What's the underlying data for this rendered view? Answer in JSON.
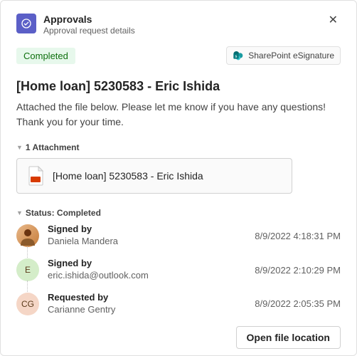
{
  "header": {
    "title": "Approvals",
    "subtitle": "Approval request details"
  },
  "status_badge": "Completed",
  "provider": "SharePoint eSignature",
  "request": {
    "title": "[Home loan] 5230583 - Eric Ishida",
    "message": "Attached the file below. Please let me know if you have any questions! Thank you for your time."
  },
  "attachments": {
    "header": "1 Attachment",
    "items": [
      {
        "name": "[Home loan] 5230583 - Eric Ishida"
      }
    ]
  },
  "status_section": {
    "header": "Status: Completed",
    "timeline": [
      {
        "action": "Signed by",
        "user": "Daniela Mandera",
        "timestamp": "8/9/2022 4:18:31 PM",
        "avatar_type": "photo",
        "avatar_bg": "#d9b38c"
      },
      {
        "action": "Signed by",
        "user": "eric.ishida@outlook.com",
        "timestamp": "8/9/2022 2:10:29 PM",
        "avatar_type": "initial",
        "avatar_text": "E",
        "avatar_bg": "#d4edc9"
      },
      {
        "action": "Requested by",
        "user": "Carianne Gentry",
        "timestamp": "8/9/2022 2:05:35 PM",
        "avatar_type": "initial",
        "avatar_text": "CG",
        "avatar_bg": "#f5d6c6"
      }
    ]
  },
  "footer": {
    "open_button": "Open file location"
  }
}
